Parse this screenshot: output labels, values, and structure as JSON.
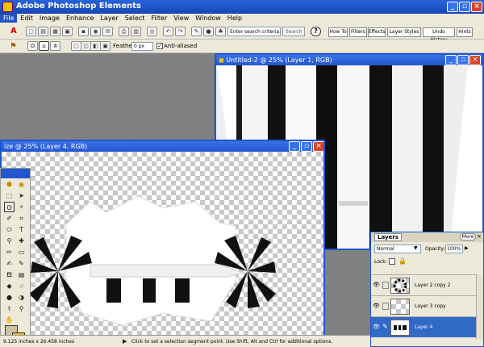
{
  "app": {
    "title": "Adobe Photoshop Elements"
  },
  "menu": [
    "File",
    "Edit",
    "Image",
    "Enhance",
    "Layer",
    "Select",
    "Filter",
    "View",
    "Window",
    "Help"
  ],
  "toolbar": {
    "search_placeholder": "Enter search criteria",
    "search_button": "Search",
    "help_icon": "?",
    "palette_tabs": [
      "How To",
      "Filters",
      "Effects",
      "Layer Styles",
      "Undo History",
      "Hints"
    ]
  },
  "options": {
    "feather_label": "Feather:",
    "feather_value": "0 px",
    "antialias_label": "Anti-aliased",
    "antialias_checked": true
  },
  "doc1": {
    "title": "Untitled-2 @ 25% (Layer 1, RGB)"
  },
  "doc2": {
    "title": "ize @ 25% (Layer 4, RGB)"
  },
  "status": {
    "size": "9.125 inches x 26.458 inches",
    "hint": "Click to set a selection segment point. Use Shift, Alt and Ctrl for additional options."
  },
  "layers": {
    "tab": "Layers",
    "more": "More",
    "blend_mode": "Normal",
    "opacity_label": "Opacity:",
    "opacity_value": "100%",
    "lock_label": "Lock:",
    "rows": [
      {
        "name": "Layer 2 copy 2",
        "selected": false
      },
      {
        "name": "Layer 3 copy",
        "selected": false
      },
      {
        "name": "Layer 4",
        "selected": true
      }
    ]
  },
  "icons": [
    "app-icon",
    "minimize-icon",
    "restore-icon",
    "close-icon",
    "new-icon",
    "open-icon",
    "save-icon",
    "print-icon",
    "undo-icon",
    "redo-icon",
    "help-icon",
    "lasso-icon",
    "move-icon",
    "zoom-icon",
    "hand-icon",
    "eye-icon",
    "lock-icon"
  ]
}
